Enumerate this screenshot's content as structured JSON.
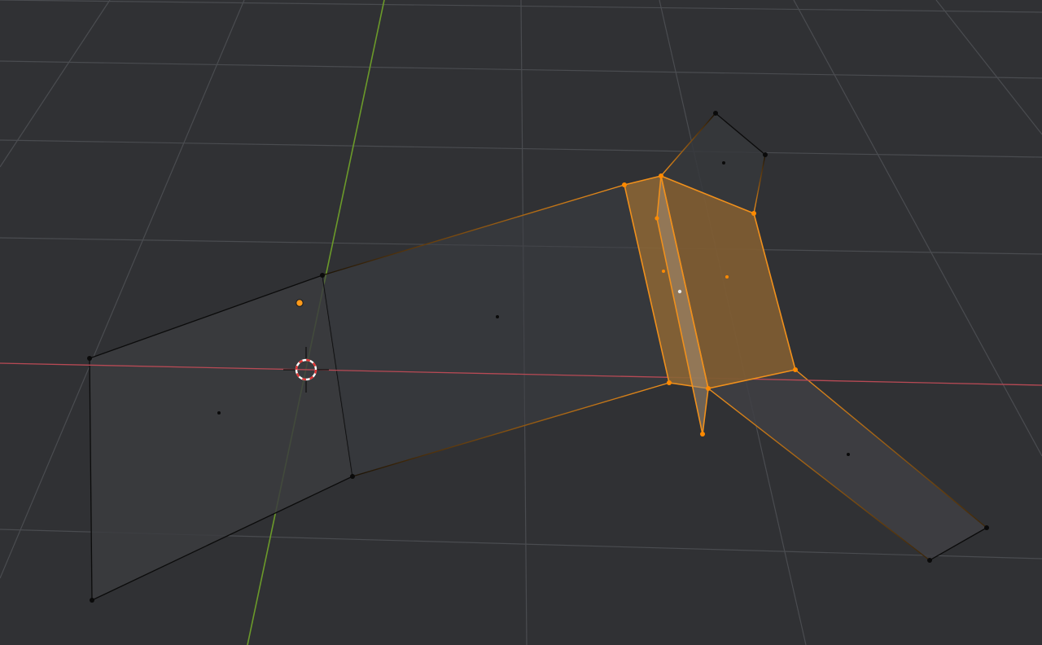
{
  "viewport": {
    "mode": "edit-mode",
    "selection": "faces"
  },
  "colors": {
    "background": "#303134",
    "grid_line": "#4a4c50",
    "x_axis": "#b84a55",
    "y_axis": "#6b9a2a",
    "selected_edge": "#f0901c",
    "selected_vertex": "#ff8a00",
    "selected_face": "#8a6535",
    "unselected_face": "#3b3c40",
    "unselected_edge": "#0b0b0b",
    "vertex": "#0a0a0a",
    "cursor_red": "#e03434",
    "cursor_white": "#ffffff",
    "origin": "#ff9a1a"
  },
  "icons": {
    "cursor": "3d-cursor-icon",
    "origin": "object-origin-icon"
  }
}
